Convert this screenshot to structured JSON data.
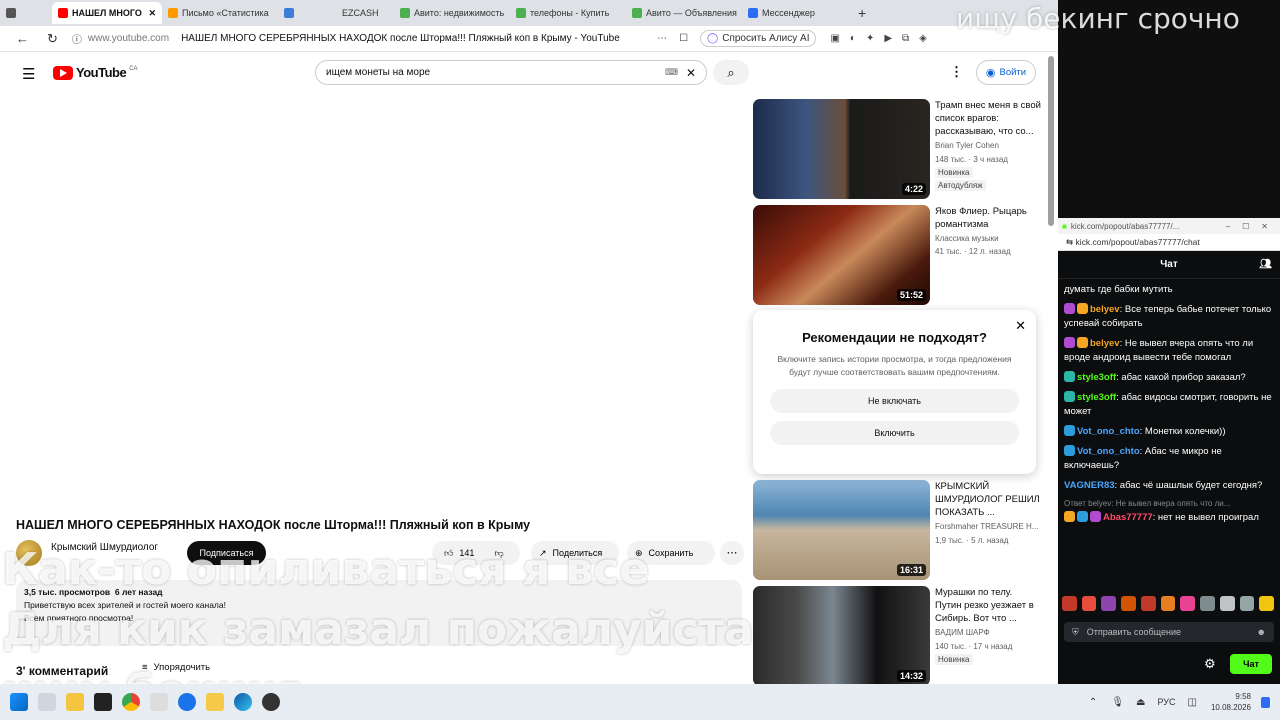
{
  "tabs": [
    {
      "label": "",
      "icon": "audio-icon"
    },
    {
      "label": "НАШЕЛ МНОГО",
      "icon": "youtube-icon",
      "active": true
    },
    {
      "label": "Письмо «Статистика",
      "icon": "mail-icon"
    },
    {
      "label": "",
      "icon": "app-icon"
    },
    {
      "label": "EZCASH",
      "icon": "none"
    },
    {
      "label": "Авито: недвижимость",
      "icon": "avito-icon"
    },
    {
      "label": "телефоны - Купить",
      "icon": "avito-icon"
    },
    {
      "label": "Авито — Объявления",
      "icon": "avito-icon"
    },
    {
      "label": "Мессенджер",
      "icon": "messenger-icon"
    }
  ],
  "overlay": {
    "top_text": "ищу бекинг срочно",
    "mid1": "Как-то опиливаться я все",
    "mid2": "Для кик замазал пожалуйста",
    "bottom": "ищу бекинг"
  },
  "address": {
    "host": "www.youtube.com",
    "title": "НАШЕЛ МНОГО СЕРЕБРЯННЫХ НАХОДОК после Шторма!!! Пляжный коп в Крыму - YouTube",
    "alice": "Спросить Алису AI"
  },
  "youtube": {
    "logo": "YouTube",
    "region": "CA",
    "search_value": "ищем монеты на море",
    "signin": "Войти"
  },
  "video": {
    "title": "НАШЕЛ МНОГО СЕРЕБРЯННЫХ НАХОДОК после Шторма!!! Пляжный коп в Крыму",
    "channel": "Крымский Шмурдиолог",
    "subscribe": "Подписаться",
    "likes": "141",
    "share": "Поделиться",
    "save": "Сохранить",
    "views": "3,5 тыс. просмотров",
    "age": "6 лет назад",
    "desc1": "Приветствую всех зрителей и гостей моего канала!",
    "desc2": "Всем приятного просмотра!",
    "comments": "3' комментарий",
    "sort": "Упорядочить"
  },
  "recs": [
    {
      "title": "Трамп внес меня в свой список врагов: рассказываю, что со...",
      "channel": "Brian Tyler Cohen",
      "meta": "148 тыс. · 3 ч назад",
      "badge": "Новинка",
      "badge2": "Автодубляж",
      "dur": "4:22"
    },
    {
      "title": "Яков Флиер. Рыцарь романтизма",
      "channel": "Классика музыки",
      "meta": "41 тыс. · 12 л. назад",
      "dur": "51:52"
    },
    {
      "title": "КРЫМСКИЙ ШМУРДИОЛОГ РЕШИЛ ПОКАЗАТЬ ...",
      "channel": "Forshmaher TREASURE H...",
      "meta": "1,9 тыс. · 5 л. назад",
      "dur": "16:31"
    },
    {
      "title": "Мурашки по телу. Путин резко уезжает в Сибирь. Вот что ...",
      "channel": "ВАДИМ ШАРФ",
      "meta": "140 тыс. · 17 ч назад",
      "badge": "Новинка",
      "dur": "14:32"
    }
  ],
  "popup": {
    "title": "Рекомендации не подходят?",
    "text": "Включите запись истории просмотра, и тогда предложения будут лучше соответствовать вашим предпочтениям.",
    "btn1": "Не включать",
    "btn2": "Включить"
  },
  "kick": {
    "url_title": "kick.com/popout/abas77777/...",
    "url": "kick.com/popout/abas77777/chat",
    "header": "Чат",
    "input": "Отправить сообщение",
    "send": "Чат"
  },
  "chat": [
    {
      "user": "",
      "text": "думать где бабки мутить",
      "color": "#ffffff"
    },
    {
      "user": "belyev",
      "text": ": Все теперь бабье потечет только успевай собирать",
      "color": "#f5a623"
    },
    {
      "user": "belyev",
      "text": ": Не вывел вчера опять что ли вроде андроид вывести тебе помогал",
      "color": "#f5a623"
    },
    {
      "user": "style3off",
      "text": ": абас какой прибор заказал?",
      "color": "#53fc18"
    },
    {
      "user": "style3off",
      "text": ": абас видосы смотрит, говорить не может",
      "color": "#53fc18"
    },
    {
      "user": "Vot_ono_chto",
      "text": ": Монетки колечки))",
      "color": "#4aa8ff"
    },
    {
      "user": "Vot_ono_chto",
      "text": ": Абас че микро не включаешь?",
      "color": "#4aa8ff"
    },
    {
      "user": "VAGNER83",
      "text": ": абас чё шашлык будет сегодня?",
      "color": "#4aa8ff"
    },
    {
      "user": "Abas77777",
      "text": ": нет не вывел проиграл",
      "color": "#ff4d6d",
      "reply": "Ответ belyev: Не вывел вчера опять что ли..."
    }
  ],
  "taskbar": {
    "lang": "РУС",
    "time": "9:58",
    "date": "10.08.2026"
  }
}
